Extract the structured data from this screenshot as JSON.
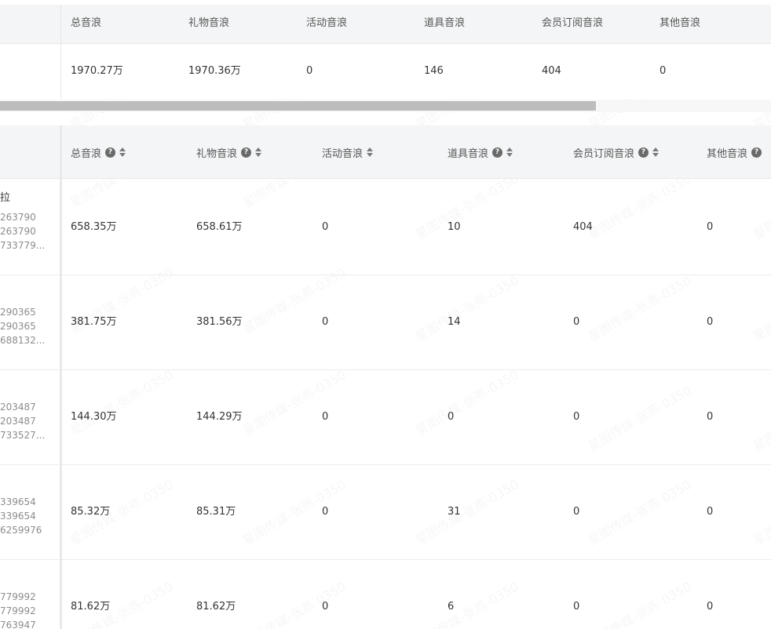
{
  "watermark": "星图传媒-张燕-0350",
  "summary": {
    "headers": [
      "总音浪",
      "礼物音浪",
      "活动音浪",
      "道具音浪",
      "会员订阅音浪",
      "其他音浪"
    ],
    "values": [
      "1970.27万",
      "1970.36万",
      "0",
      "146",
      "404",
      "0"
    ]
  },
  "detail": {
    "headers": [
      {
        "label": "总音浪",
        "help": true,
        "sort": true
      },
      {
        "label": "礼物音浪",
        "help": true,
        "sort": true
      },
      {
        "label": "活动音浪",
        "help": false,
        "sort": true
      },
      {
        "label": "道具音浪",
        "help": true,
        "sort": true
      },
      {
        "label": "会员订阅音浪",
        "help": true,
        "sort": true
      },
      {
        "label": "其他音浪",
        "help": true,
        "sort": false
      }
    ],
    "help_glyph": "?",
    "rows": [
      {
        "name": "拉",
        "ids": [
          "263790",
          "263790",
          "733779..."
        ],
        "values": [
          "658.35万",
          "658.61万",
          "0",
          "10",
          "404",
          "0"
        ]
      },
      {
        "name": "",
        "ids": [
          "290365",
          "290365",
          "688132..."
        ],
        "values": [
          "381.75万",
          "381.56万",
          "0",
          "14",
          "0",
          "0"
        ]
      },
      {
        "name": "",
        "ids": [
          "203487",
          "203487",
          "733527..."
        ],
        "values": [
          "144.30万",
          "144.29万",
          "0",
          "0",
          "0",
          "0"
        ]
      },
      {
        "name": "",
        "ids": [
          "339654",
          "339654",
          "6259976"
        ],
        "values": [
          "85.32万",
          "85.31万",
          "0",
          "31",
          "0",
          "0"
        ]
      },
      {
        "name": "",
        "ids": [
          "779992",
          "779992",
          "763947"
        ],
        "values": [
          "81.62万",
          "81.62万",
          "0",
          "6",
          "0",
          "0"
        ]
      }
    ]
  },
  "colors": {
    "header_bg": "#f4f5f6",
    "scroll_thumb": "#bdbdbd",
    "help_icon": "#6a6a6a"
  }
}
